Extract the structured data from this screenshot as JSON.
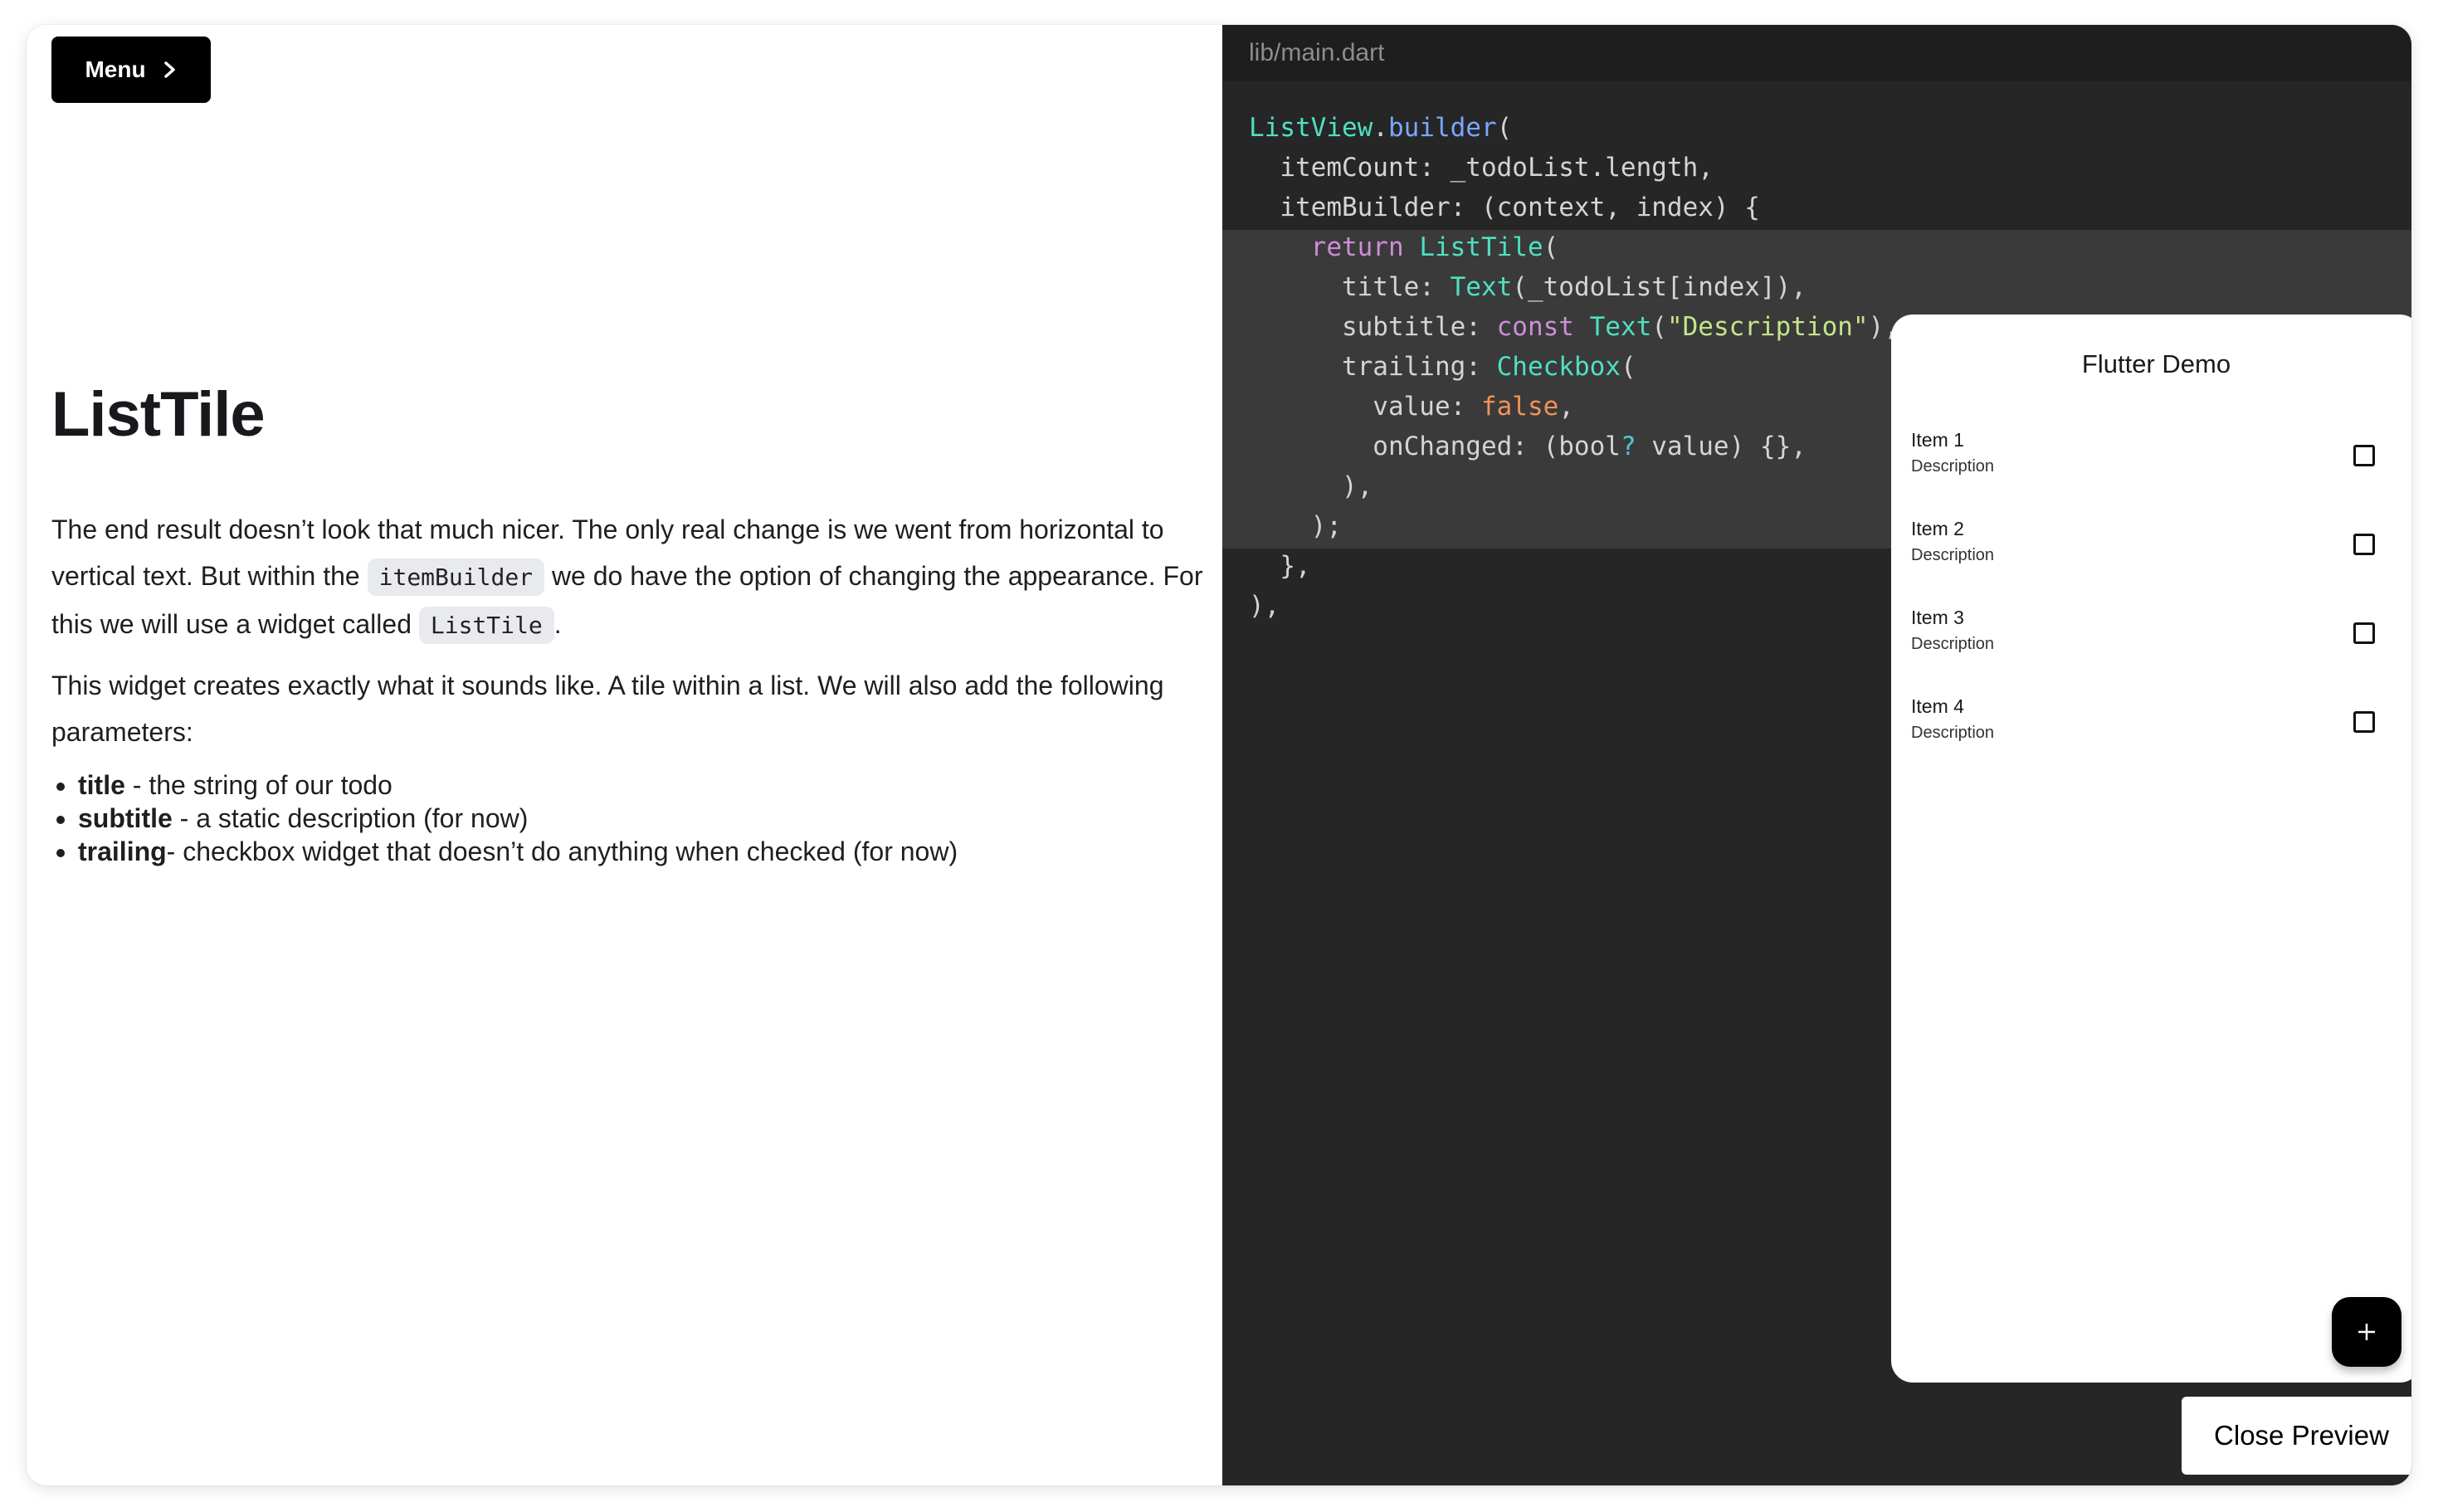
{
  "menu": {
    "label": "Menu",
    "icon": "chevron-right-icon"
  },
  "article": {
    "heading": "ListTile",
    "paragraph1": {
      "part1": "The end result doesn’t look that much nicer. The only real change is we went from horizontal to vertical text. But within the ",
      "code1": "itemBuilder",
      "part2": " we do have the option of changing the appearance. For this we will use a widget called ",
      "code2": "ListTile",
      "part3": "."
    },
    "paragraph2": "This widget creates exactly what it sounds like. A tile within a list. We will also add the following parameters:",
    "bullets": [
      {
        "term": "title",
        "text": " - the string of our todo"
      },
      {
        "term": "subtitle",
        "text": " - a static description (for now)"
      },
      {
        "term": "trailing",
        "text": "- checkbox widget that doesn’t do anything when checked (for now)"
      }
    ]
  },
  "editor": {
    "filename": "lib/main.dart",
    "highlighted_lines": [
      4,
      11
    ],
    "colors": {
      "header_bg": "#1e1e1e",
      "code_bg": "#262626",
      "highlight_bg": "#3a3a3a",
      "class": "#4fe0c2",
      "method": "#7aa7ff",
      "keyword": "#cc8fd6",
      "string": "#c5e58a",
      "boolean": "#f0925a"
    },
    "lines": [
      [
        {
          "t": "ListView",
          "c": "cls"
        },
        {
          "t": "."
        },
        {
          "t": "builder",
          "c": "fn"
        },
        {
          "t": "("
        }
      ],
      [
        {
          "t": "  itemCount: _todoList.length,"
        }
      ],
      [
        {
          "t": "  itemBuilder: (context, index) {"
        }
      ],
      [
        {
          "t": "    "
        },
        {
          "t": "return",
          "c": "kw"
        },
        {
          "t": " "
        },
        {
          "t": "ListTile",
          "c": "cls"
        },
        {
          "t": "("
        }
      ],
      [
        {
          "t": "      title: "
        },
        {
          "t": "Text",
          "c": "cls"
        },
        {
          "t": "(_todoList[index]),"
        }
      ],
      [
        {
          "t": "      subtitle: "
        },
        {
          "t": "const",
          "c": "kw"
        },
        {
          "t": " "
        },
        {
          "t": "Text",
          "c": "cls"
        },
        {
          "t": "("
        },
        {
          "t": "\"Description\"",
          "c": "str"
        },
        {
          "t": "),"
        }
      ],
      [
        {
          "t": "      trailing: "
        },
        {
          "t": "Checkbox",
          "c": "cls"
        },
        {
          "t": "("
        }
      ],
      [
        {
          "t": "        value: "
        },
        {
          "t": "false",
          "c": "bool"
        },
        {
          "t": ","
        }
      ],
      [
        {
          "t": "        onChanged: (bool"
        },
        {
          "t": "?",
          "c": "q"
        },
        {
          "t": " value) {},"
        }
      ],
      [
        {
          "t": "      ),"
        }
      ],
      [
        {
          "t": "    );"
        }
      ],
      [
        {
          "t": "  },"
        }
      ],
      [
        {
          "t": "),"
        }
      ]
    ]
  },
  "preview": {
    "app_title": "Flutter Demo",
    "items": [
      {
        "title": "Item 1",
        "subtitle": "Description",
        "checked": false
      },
      {
        "title": "Item 2",
        "subtitle": "Description",
        "checked": false
      },
      {
        "title": "Item 3",
        "subtitle": "Description",
        "checked": false
      },
      {
        "title": "Item 4",
        "subtitle": "Description",
        "checked": false
      }
    ],
    "fab_icon": "plus-icon",
    "close_label": "Close Preview"
  }
}
